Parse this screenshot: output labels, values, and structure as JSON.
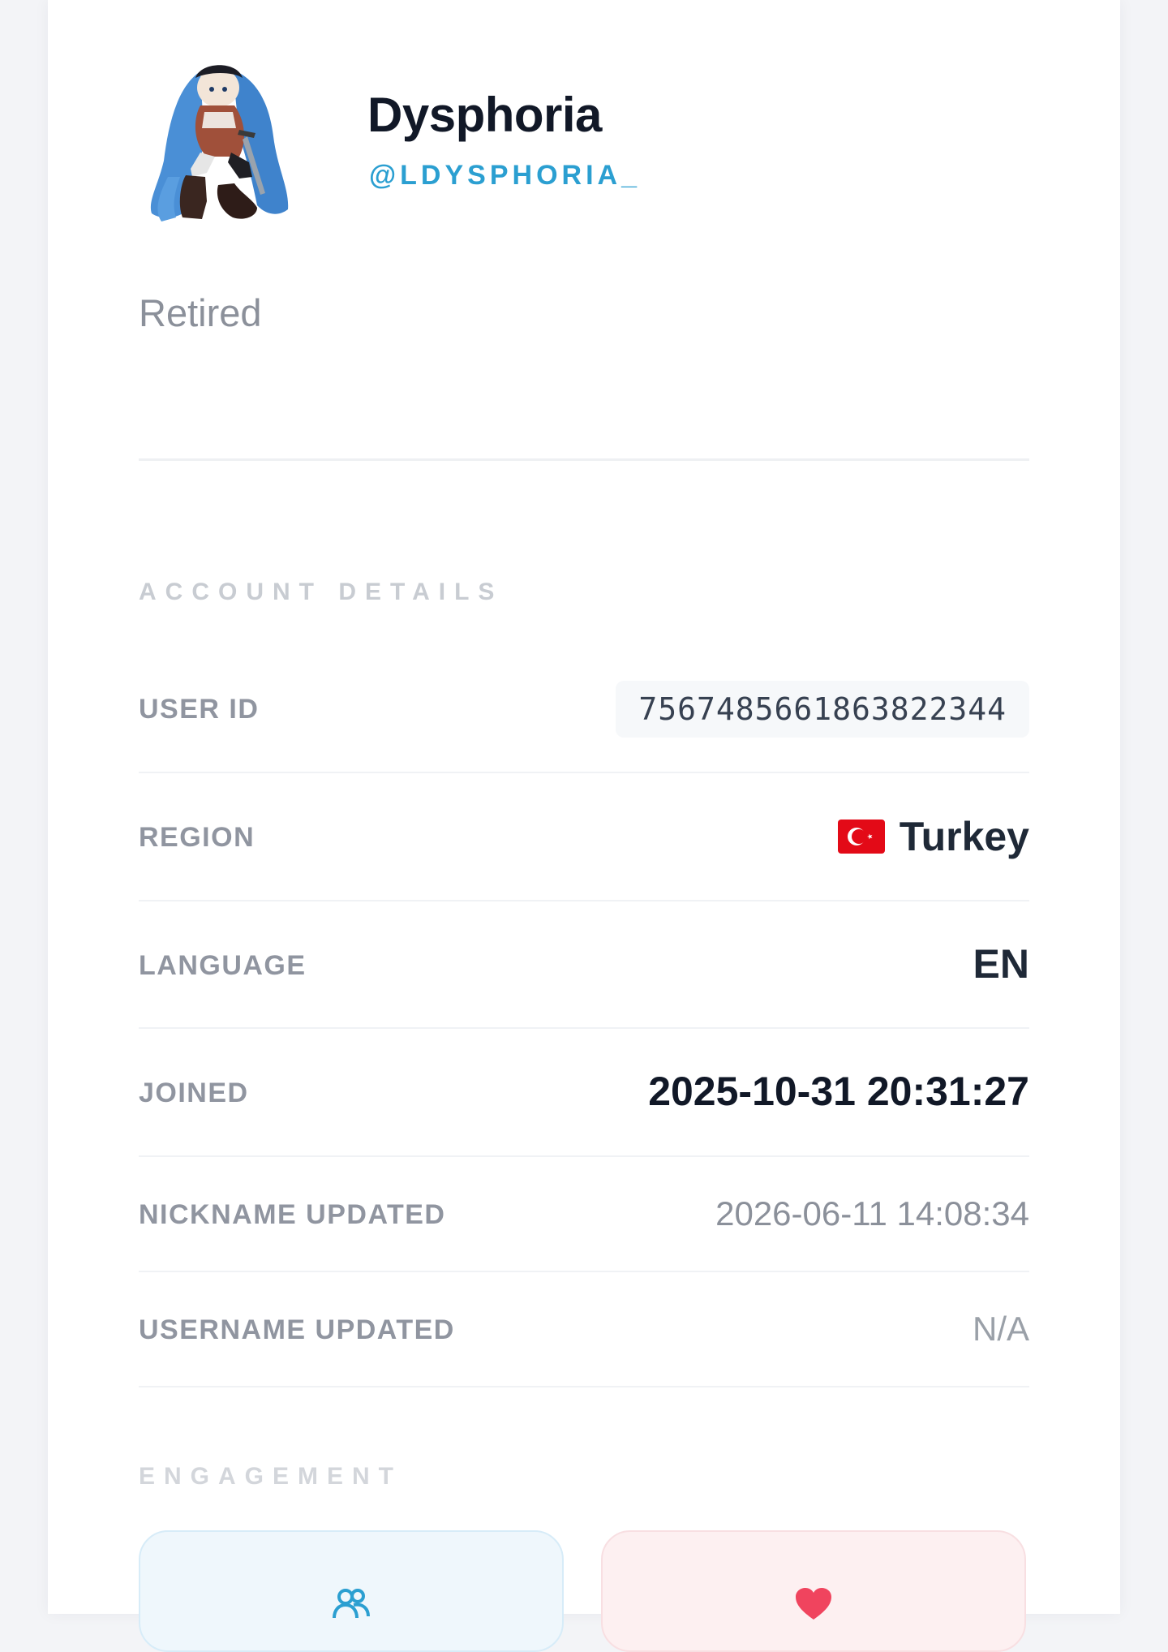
{
  "profile": {
    "display_name": "Dysphoria",
    "username": "@LDYSPHORIA_",
    "bio": "Retired"
  },
  "account_details": {
    "title": "ACCOUNT DETAILS",
    "user_id_label": "USER ID",
    "user_id": "7567485661863822344",
    "region_label": "REGION",
    "region": "Turkey",
    "region_flag_icon": "flag-turkey-icon",
    "language_label": "LANGUAGE",
    "language": "EN",
    "joined_label": "JOINED",
    "joined": "2025-10-31 20:31:27",
    "nickname_updated_label": "NICKNAME UPDATED",
    "nickname_updated": "2026-06-11 14:08:34",
    "username_updated_label": "USERNAME UPDATED",
    "username_updated": "N/A"
  },
  "engagement": {
    "title": "ENGAGEMENT",
    "tiles": [
      {
        "icon": "users-icon",
        "color": "#2b9fd1"
      },
      {
        "icon": "heart-icon",
        "color": "#f0445e"
      }
    ]
  },
  "colors": {
    "accent": "#2b9fd1",
    "likes": "#f0445e",
    "page_background": "#f3f4f7"
  }
}
